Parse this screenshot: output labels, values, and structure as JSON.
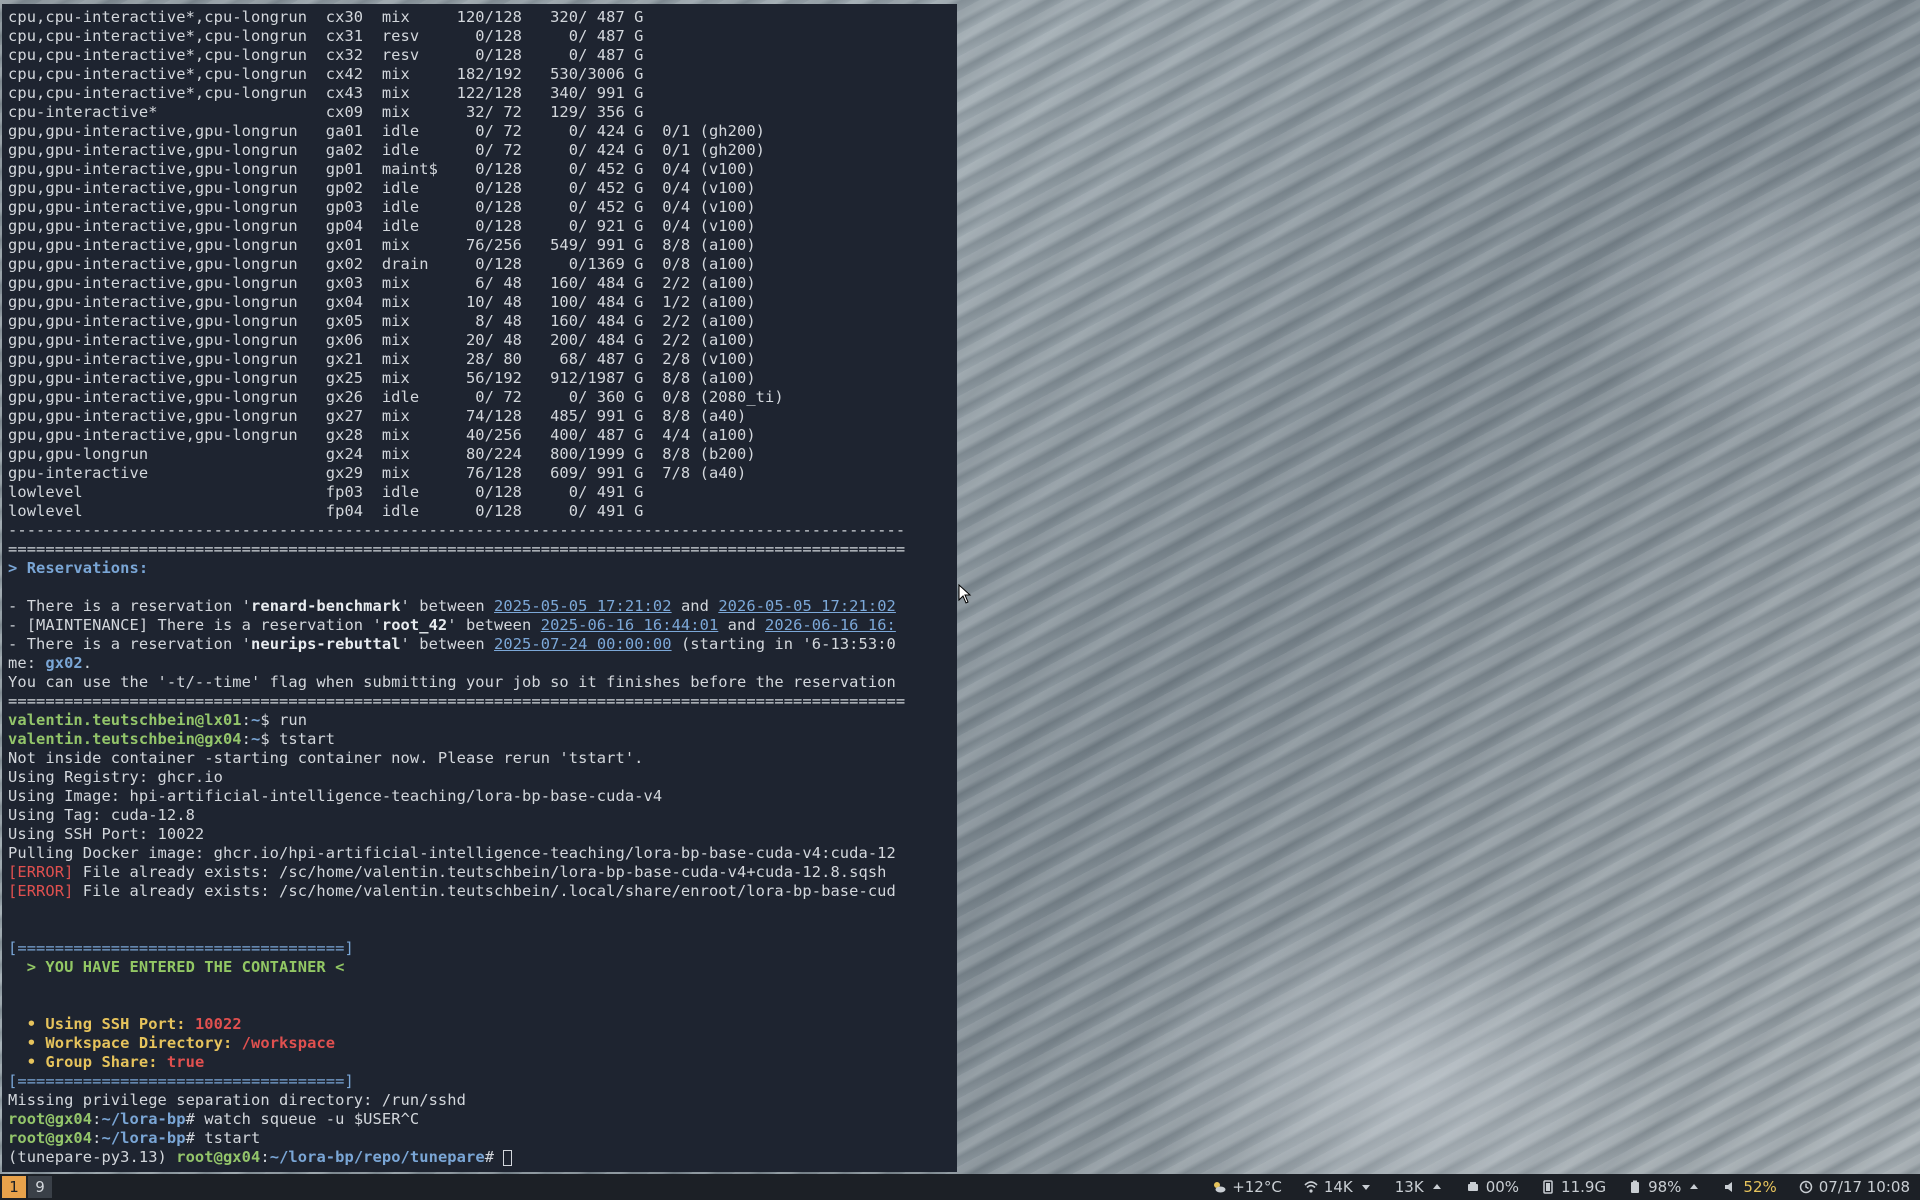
{
  "desktop": {
    "wallpaper": "martian dunes"
  },
  "terminal": {
    "lines": [
      "cpu,cpu-interactive*,cpu-longrun  cx30  mix     120/128   320/ 487 G",
      "cpu,cpu-interactive*,cpu-longrun  cx31  resv      0/128     0/ 487 G",
      "cpu,cpu-interactive*,cpu-longrun  cx32  resv      0/128     0/ 487 G",
      "cpu,cpu-interactive*,cpu-longrun  cx42  mix     182/192   530/3006 G",
      "cpu,cpu-interactive*,cpu-longrun  cx43  mix     122/128   340/ 991 G",
      "cpu-interactive*                  cx09  mix      32/ 72   129/ 356 G",
      "gpu,gpu-interactive,gpu-longrun   ga01  idle      0/ 72     0/ 424 G  0/1 (gh200)",
      "gpu,gpu-interactive,gpu-longrun   ga02  idle      0/ 72     0/ 424 G  0/1 (gh200)",
      "gpu,gpu-interactive,gpu-longrun   gp01  maint$    0/128     0/ 452 G  0/4 (v100)",
      "gpu,gpu-interactive,gpu-longrun   gp02  idle      0/128     0/ 452 G  0/4 (v100)",
      "gpu,gpu-interactive,gpu-longrun   gp03  idle      0/128     0/ 452 G  0/4 (v100)",
      "gpu,gpu-interactive,gpu-longrun   gp04  idle      0/128     0/ 921 G  0/4 (v100)",
      "gpu,gpu-interactive,gpu-longrun   gx01  mix      76/256   549/ 991 G  8/8 (a100)",
      "gpu,gpu-interactive,gpu-longrun   gx02  drain     0/128     0/1369 G  0/8 (a100)",
      "gpu,gpu-interactive,gpu-longrun   gx03  mix       6/ 48   160/ 484 G  2/2 (a100)",
      "gpu,gpu-interactive,gpu-longrun   gx04  mix      10/ 48   100/ 484 G  1/2 (a100)",
      "gpu,gpu-interactive,gpu-longrun   gx05  mix       8/ 48   160/ 484 G  2/2 (a100)",
      "gpu,gpu-interactive,gpu-longrun   gx06  mix      20/ 48   200/ 484 G  2/2 (a100)",
      "gpu,gpu-interactive,gpu-longrun   gx21  mix      28/ 80    68/ 487 G  2/8 (v100)",
      "gpu,gpu-interactive,gpu-longrun   gx25  mix      56/192   912/1987 G  8/8 (a100)",
      "gpu,gpu-interactive,gpu-longrun   gx26  idle      0/ 72     0/ 360 G  0/8 (2080_ti)",
      "gpu,gpu-interactive,gpu-longrun   gx27  mix      74/128   485/ 991 G  8/8 (a40)",
      "gpu,gpu-interactive,gpu-longrun   gx28  mix      40/256   400/ 487 G  4/4 (a100)",
      "gpu,gpu-longrun                   gx24  mix      80/224   800/1999 G  8/8 (b200)",
      "gpu-interactive                   gx29  mix      76/128   609/ 991 G  7/8 (a40)",
      "lowlevel                          fp03  idle      0/128     0/ 491 G",
      "lowlevel                          fp04  idle      0/128     0/ 491 G",
      "------------------------------------------------------------------------------------------------",
      "================================================================================================",
      "> Reservations:",
      "",
      "- There is a reservation 'renard-benchmark' between 2025-05-05 17:21:02 and 2026-05-05 17:21:02",
      "- [MAINTENANCE] There is a reservation 'root_42' between 2025-06-16 16:44:01 and 2026-06-16 16:",
      "- There is a reservation 'neurips-rebuttal' between 2025-07-24 00:00:00 (starting in '6-13:53:0",
      "me: gx02.",
      "You can use the '-t/--time' flag when submitting your job so it finishes before the reservation",
      "================================================================================================",
      "valentin.teutschbein@lx01:~$ run",
      "valentin.teutschbein@gx04:~$ tstart",
      "Not inside container -starting container now. Please rerun 'tstart'.",
      "Using Registry: ghcr.io",
      "Using Image: hpi-artificial-intelligence-teaching/lora-bp-base-cuda-v4",
      "Using Tag: cuda-12.8",
      "Using SSH Port: 10022",
      "Pulling Docker image: ghcr.io/hpi-artificial-intelligence-teaching/lora-bp-base-cuda-v4:cuda-12",
      "[ERROR] File already exists: /sc/home/valentin.teutschbein/lora-bp-base-cuda-v4+cuda-12.8.sqsh",
      "[ERROR] File already exists: /sc/home/valentin.teutschbein/.local/share/enroot/lora-bp-base-cud",
      "",
      "",
      "[===================================]",
      "  > YOU HAVE ENTERED THE CONTAINER <",
      "",
      "",
      "  • Using SSH Port: 10022",
      "  • Workspace Directory: /workspace",
      "  • Group Share: true",
      "[===================================]",
      "Missing privilege separation directory: /run/sshd",
      "root@gx04:~/lora-bp# watch squeue -u $USER^C",
      "root@gx04:~/lora-bp# tstart",
      "(tunepare-py3.13) root@gx04:~/lora-bp/repo/tunepare# "
    ]
  },
  "bar": {
    "workspaces": [
      "1",
      "9"
    ],
    "weather": "+12°C",
    "net_down": "14K",
    "net_up": "13K",
    "cpu": "00%",
    "memory": "11.9G",
    "battery": "98%",
    "volume": "52%",
    "datetime": "07/17 10:08"
  }
}
